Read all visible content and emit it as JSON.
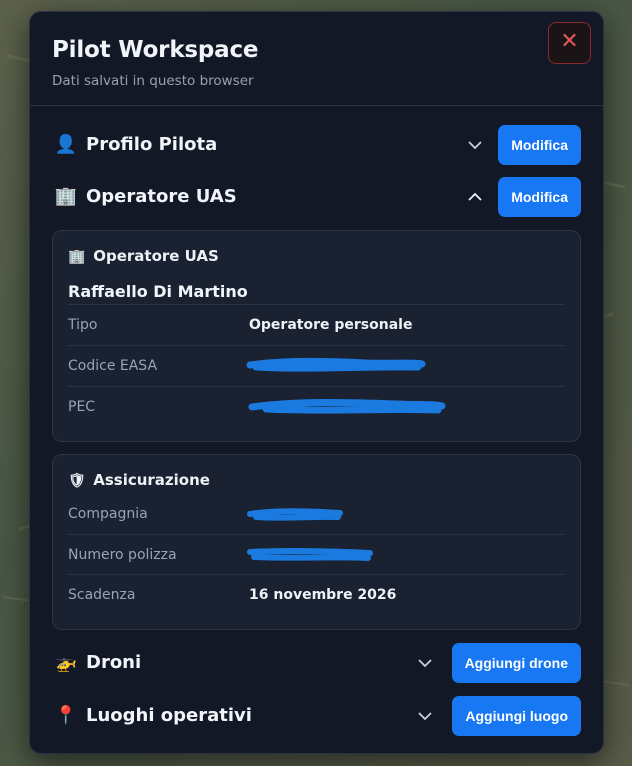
{
  "header": {
    "title": "Pilot Workspace",
    "subtitle": "Dati salvati in questo browser",
    "close_symbol": "✕"
  },
  "sections": {
    "profilo": {
      "icon": "👤",
      "title": "Profilo Pilota",
      "button": "Modifica",
      "expanded": false
    },
    "operatore": {
      "icon": "🏢",
      "title": "Operatore UAS",
      "button": "Modifica",
      "expanded": true
    },
    "droni": {
      "icon": "🚁",
      "title": "Droni",
      "button": "Aggiungi drone",
      "expanded": false
    },
    "luoghi": {
      "icon": "📍",
      "title": "Luoghi operativi",
      "button": "Aggiungi luogo",
      "expanded": false
    }
  },
  "operator_card": {
    "icon": "🏢",
    "heading": "Operatore UAS",
    "name": "Raffaello Di Martino",
    "rows": [
      {
        "label": "Tipo",
        "value": "Operatore personale"
      },
      {
        "label": "Codice EASA",
        "value": ""
      },
      {
        "label": "PEC",
        "value": ""
      }
    ]
  },
  "insurance_card": {
    "icon": "🛡",
    "heading": "Assicurazione",
    "rows": [
      {
        "label": "Compagnia",
        "value": ""
      },
      {
        "label": "Numero polizza",
        "value": ""
      },
      {
        "label": "Scadenza",
        "value": "16 novembre 2026"
      }
    ]
  },
  "colors": {
    "accent": "#1877f2",
    "panel_bg": "#121826",
    "card_bg": "#1a2130",
    "close_red": "#e25555",
    "redaction_blue": "#1a7ae0"
  },
  "icons": {
    "close": "close-icon",
    "chevron_down": "chevron-down-icon",
    "chevron_up": "chevron-up-icon"
  }
}
